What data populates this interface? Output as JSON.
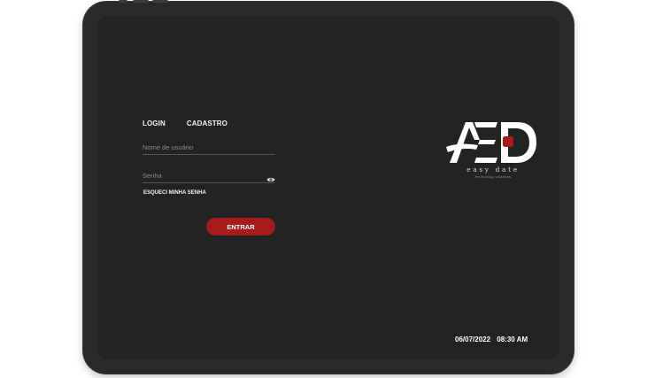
{
  "tabs": [
    {
      "label": "LOGIN"
    },
    {
      "label": "CADASTRO"
    }
  ],
  "form": {
    "username_placeholder": "Nome de usuário",
    "password_placeholder": "Senha",
    "forgot_label": "ESQUECI MINHA SENHA",
    "submit_label": "ENTRAR",
    "eye_icon": "eye-icon"
  },
  "brand": {
    "logo_icon": "aed-logo-icon",
    "name": "easy date",
    "tagline": "technology solutions",
    "accent_color": "#a51b1b"
  },
  "status": {
    "date": "06/07/2022",
    "time": "08:30 AM"
  },
  "colors": {
    "screen_bg": "#232323",
    "bezel": "#2a2a2a",
    "text": "#f2f2f2",
    "button": "#a51b1b"
  }
}
